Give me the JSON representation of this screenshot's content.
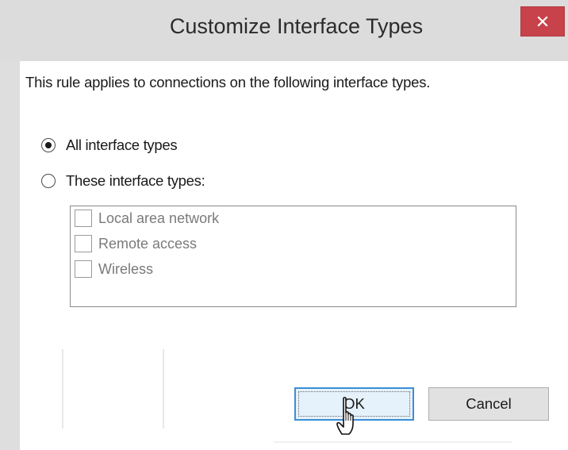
{
  "dialog": {
    "title": "Customize Interface Types",
    "description": "This rule applies to connections on the following interface types.",
    "colors": {
      "close_button": "#c7424a",
      "ok_border": "#3c8ed6",
      "titlebar": "#dcdcdc"
    }
  },
  "options": {
    "all_types": {
      "label": "All interface types",
      "selected": true
    },
    "these_types": {
      "label": "These interface types:",
      "selected": false
    }
  },
  "interface_list": {
    "enabled": false,
    "items": [
      {
        "label": "Local area network",
        "checked": false
      },
      {
        "label": "Remote access",
        "checked": false
      },
      {
        "label": "Wireless",
        "checked": false
      }
    ]
  },
  "buttons": {
    "ok": "OK",
    "cancel": "Cancel"
  },
  "icons": {
    "close": "close-icon",
    "cursor": "hand-pointer-icon"
  }
}
